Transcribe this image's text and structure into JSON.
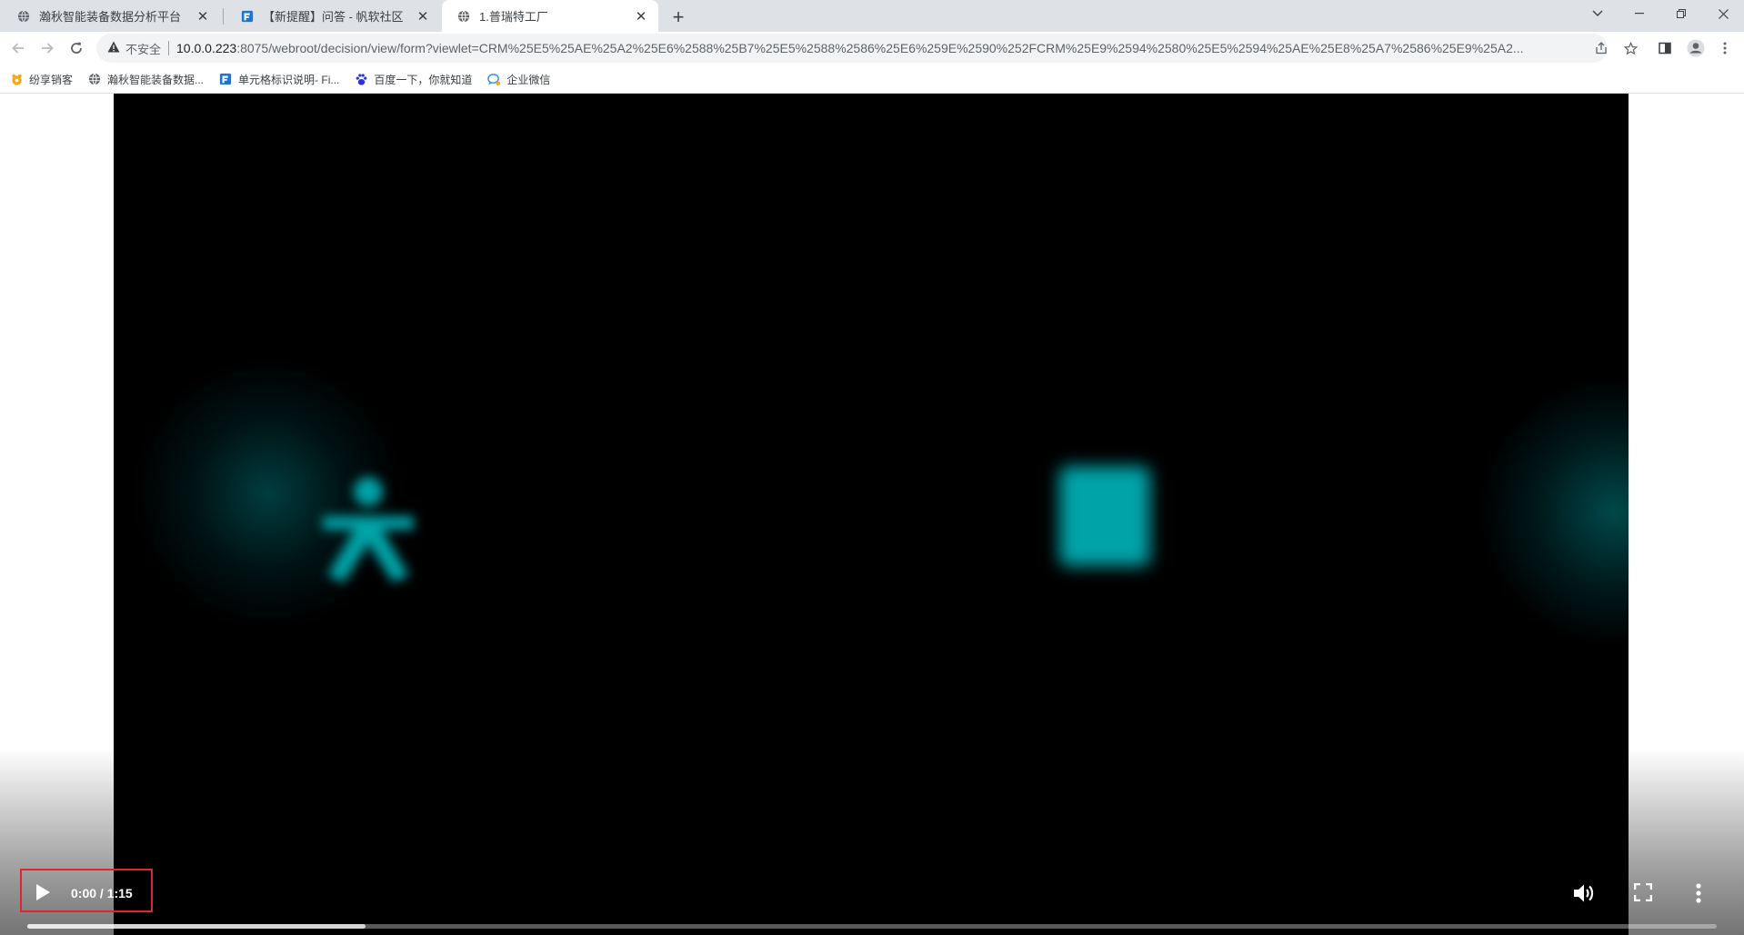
{
  "tabs": [
    {
      "title": "瀚秋智能装备数据分析平台",
      "favicon": "globe-icon",
      "active": false
    },
    {
      "title": "【新提醒】问答 - 帆软社区",
      "favicon": "fanruan-logo-icon",
      "active": false
    },
    {
      "title": "1.普瑞特工厂",
      "favicon": "globe-icon",
      "active": true
    }
  ],
  "address_bar": {
    "security_label": "不安全",
    "url_host": "10.0.0.223",
    "url_rest": ":8075/webroot/decision/view/form?viewlet=CRM%25E5%25AE%25A2%25E6%2588%25B7%25E5%2588%2586%25E6%259E%2590%252FCRM%25E9%2594%2580%25E5%2594%25AE%25E8%25A7%2586%25E9%25A2..."
  },
  "bookmarks": [
    {
      "label": "纷享销客",
      "icon": "fxiaoke-icon"
    },
    {
      "label": "瀚秋智能装备数据...",
      "icon": "globe-icon"
    },
    {
      "label": "单元格标识说明- Fi...",
      "icon": "fanruan-logo-icon"
    },
    {
      "label": "百度一下，你就知道",
      "icon": "baidu-paw-icon"
    },
    {
      "label": "企业微信",
      "icon": "wecom-icon"
    }
  ],
  "video": {
    "time_display": "0:00 / 1:15",
    "buffered_fraction": 0.2
  },
  "colors": {
    "highlight_box": "#e0262b",
    "glow": "#00a3a8"
  }
}
